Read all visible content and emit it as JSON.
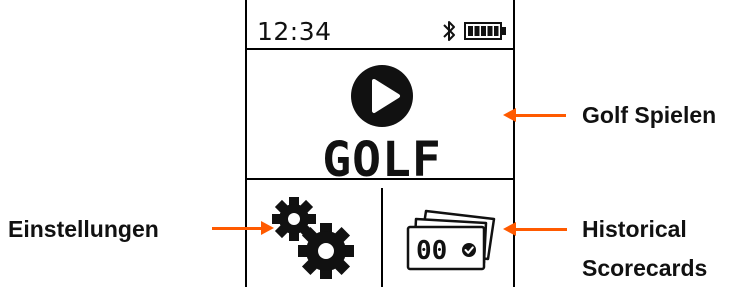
{
  "status_bar": {
    "time": "12:34",
    "bluetooth_icon": "bluetooth-icon",
    "battery_icon": "battery-full-icon"
  },
  "main_tile": {
    "label": "GOLF",
    "icon": "play-icon"
  },
  "bottom_tiles": {
    "settings_icon": "gears-icon",
    "scorecards_icon": "scorecards-icon",
    "scorecard_text": "00"
  },
  "callouts": {
    "golf_spielen": "Golf Spielen",
    "einstellungen": "Einstellungen",
    "historical_line1": "Historical",
    "historical_line2": "Scorecards"
  },
  "colors": {
    "arrow": "#ff5a00",
    "ink": "#111111"
  }
}
